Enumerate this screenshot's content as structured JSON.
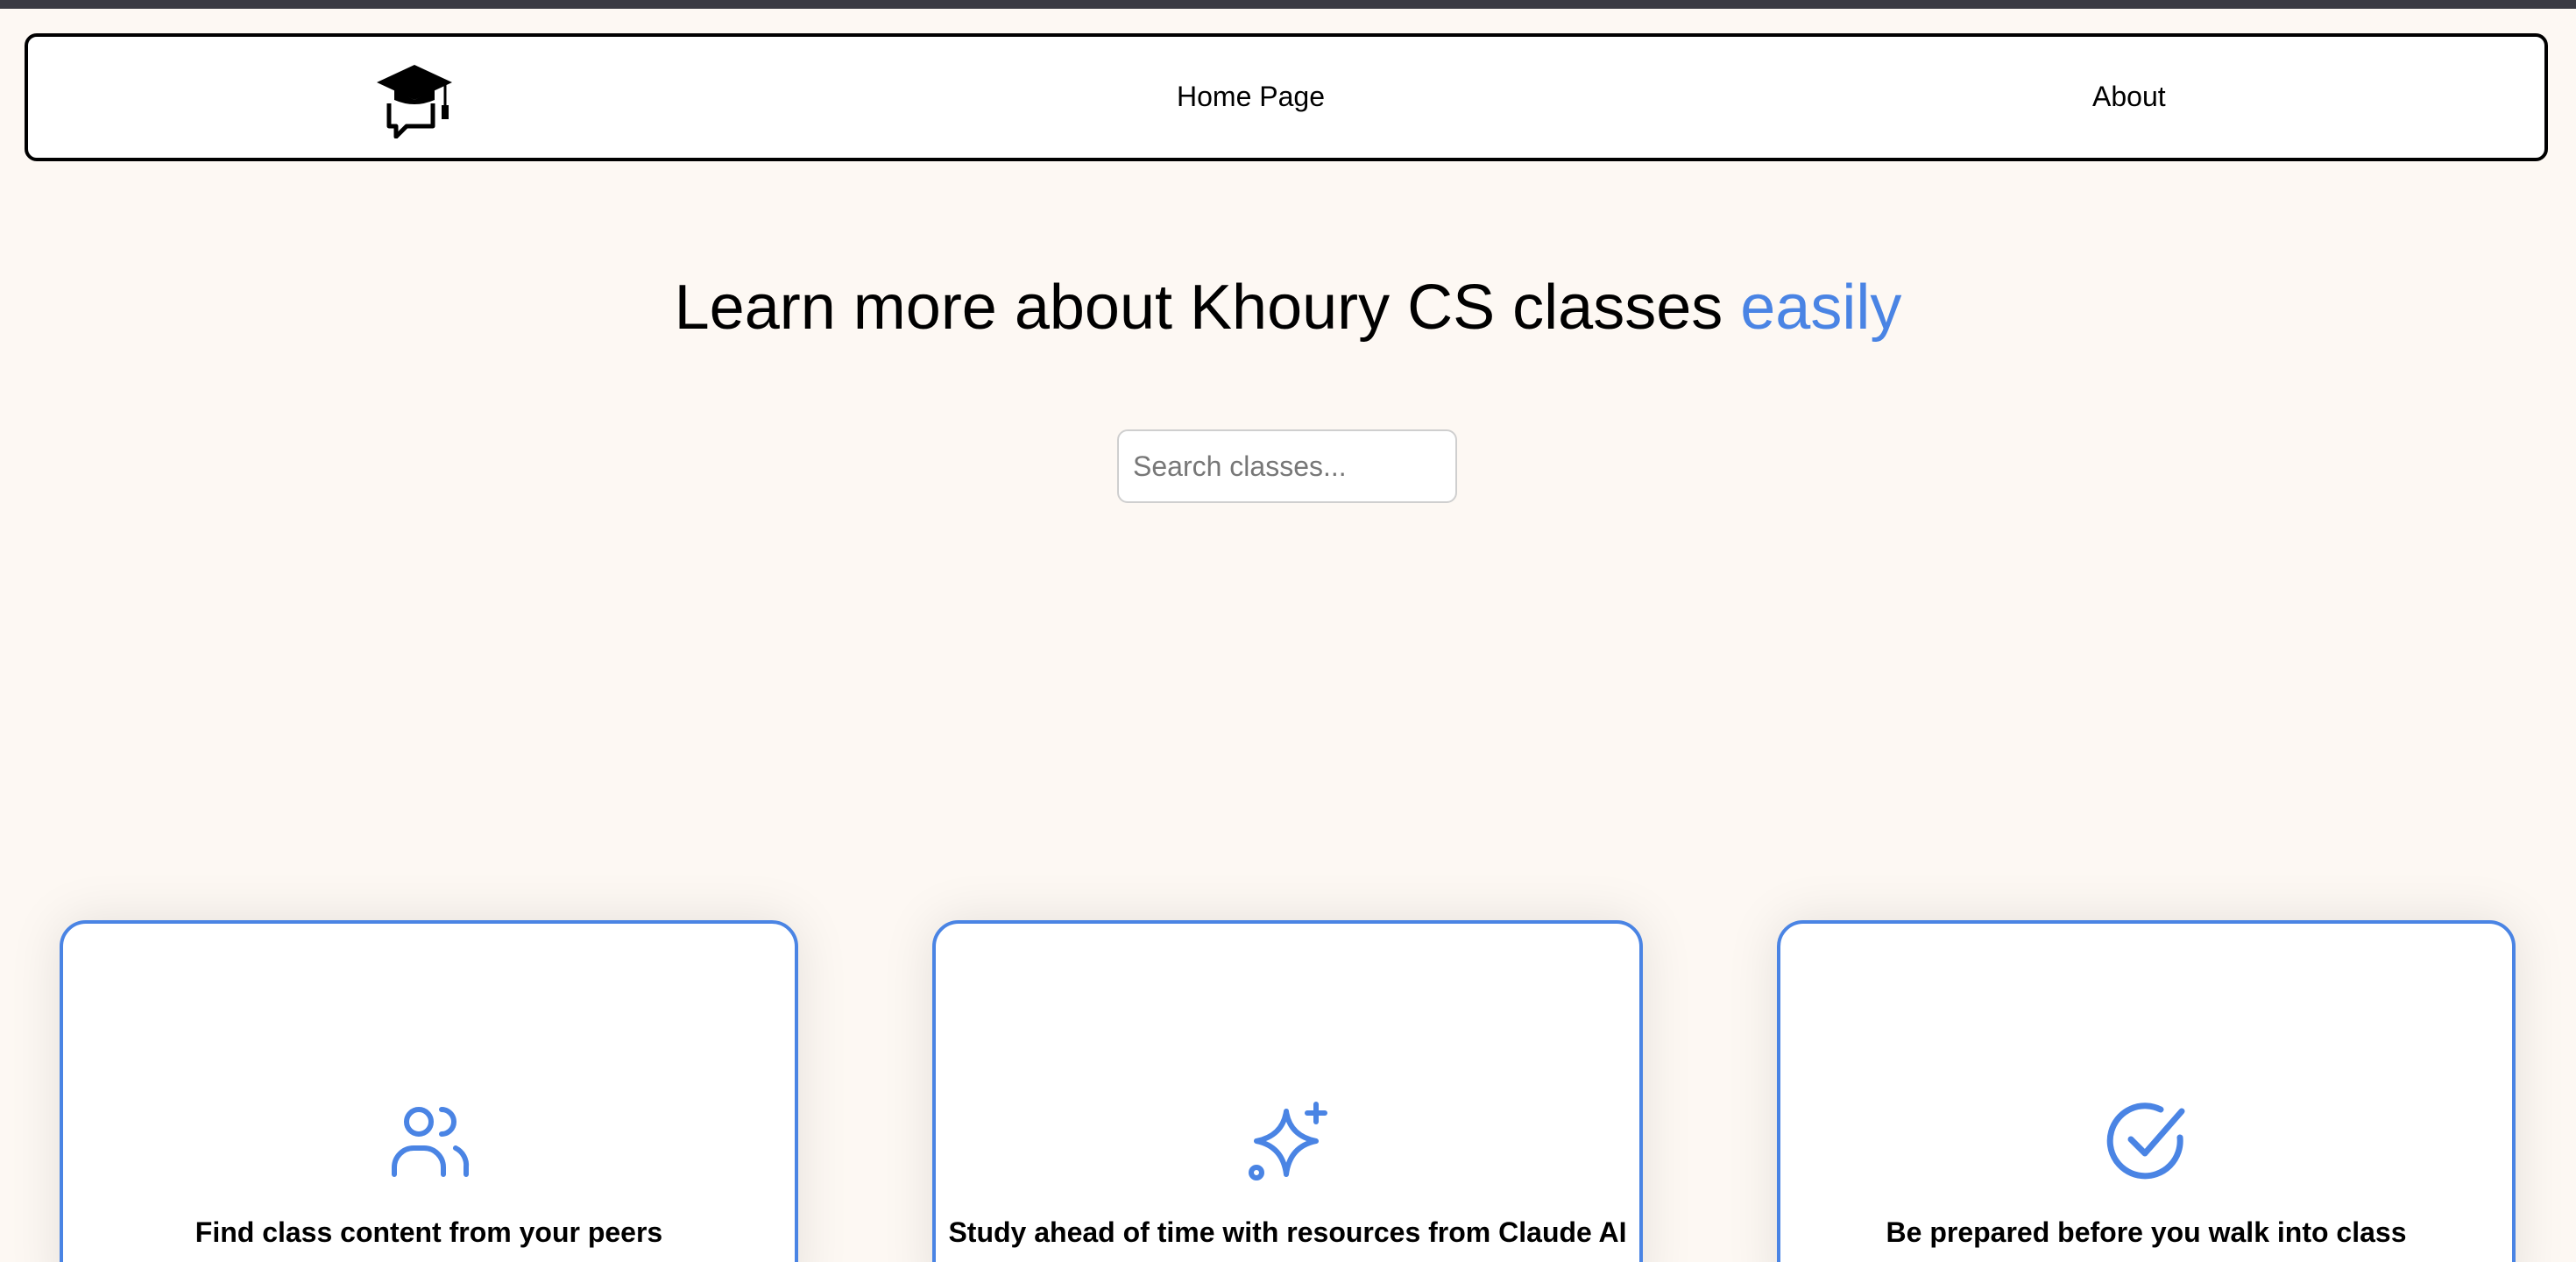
{
  "nav": {
    "logo_icon": "graduation-cap-chat-icon",
    "home_label": "Home Page",
    "about_label": "About"
  },
  "hero": {
    "headline_main": "Learn more about Khoury CS classes ",
    "headline_accent": "easily",
    "accent_color": "#4a84e4"
  },
  "search": {
    "placeholder": "Search classes...",
    "value": ""
  },
  "features": [
    {
      "icon": "users-icon",
      "text": "Find class content from your peers"
    },
    {
      "icon": "sparkle-icon",
      "text": "Study ahead of time with resources from Claude AI"
    },
    {
      "icon": "check-circle-icon",
      "text": "Be prepared before you walk into class"
    }
  ]
}
